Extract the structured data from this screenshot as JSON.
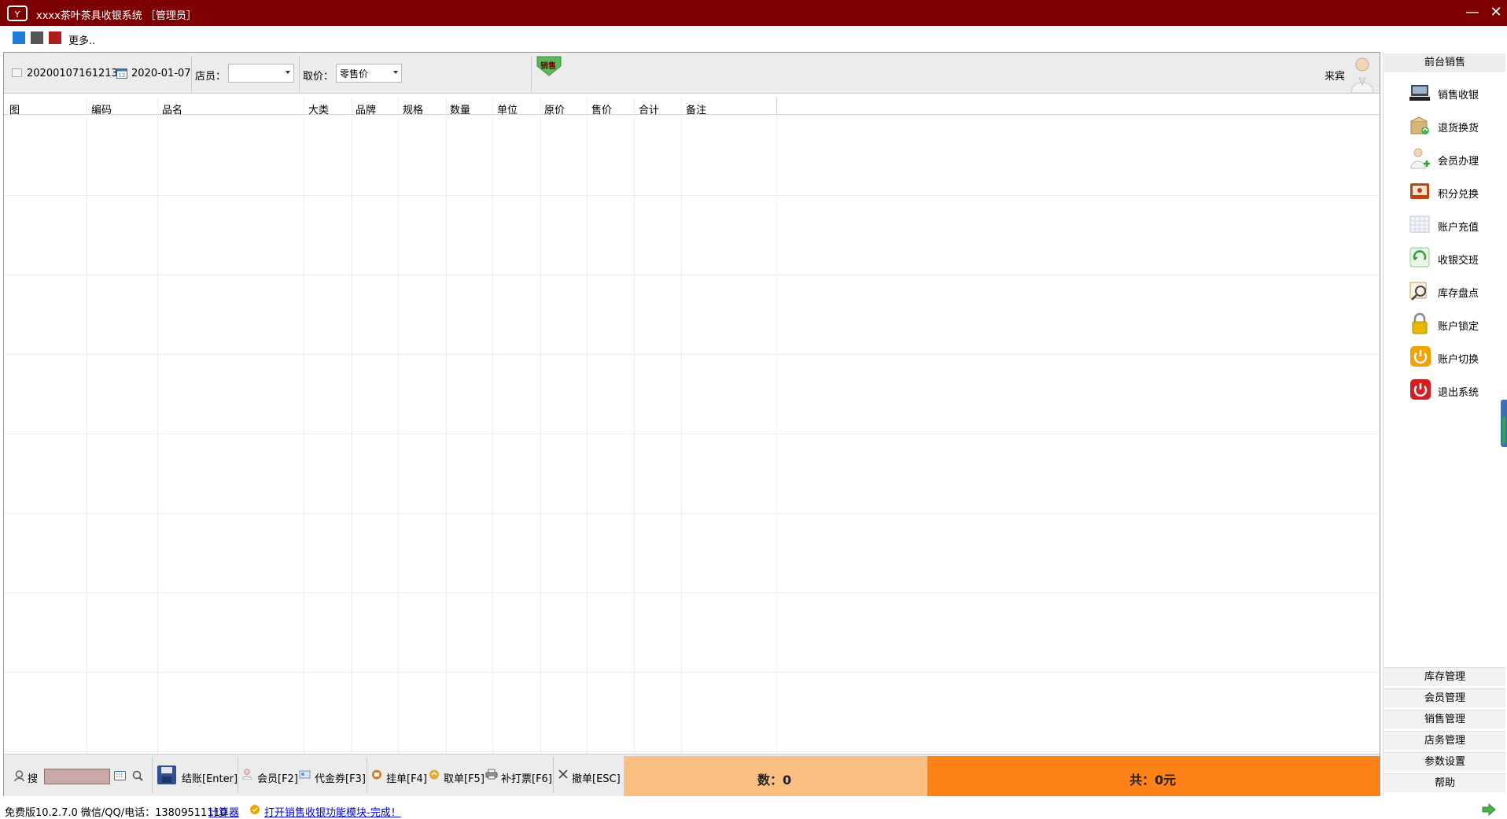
{
  "window": {
    "title": "xxxx茶叶茶具收银系统 ［管理员］",
    "minimize": "—",
    "close": "✕"
  },
  "skins": {
    "colors": [
      "#1e7bd6",
      "#555555",
      "#b01c1c"
    ],
    "more": "更多.."
  },
  "toolbar": {
    "order_no": "20200107161213",
    "date": "2020-01-07",
    "clerk_label": "店员：",
    "clerk_value": "",
    "price_label": "取价：",
    "price_value": "零售价",
    "mode_badge": "销售",
    "customer": "来宾"
  },
  "grid": {
    "columns": [
      "图",
      "编码",
      "品名",
      "大类",
      "品牌",
      "规格",
      "数量",
      "单位",
      "原价",
      "售价",
      "合计",
      "备注"
    ],
    "rows": []
  },
  "bottom": {
    "search_label": "搜",
    "search_value": "",
    "checkout": "结账[Enter]",
    "member": "会员[F2]",
    "voucher": "代金券[F3]",
    "hold": "挂单[F4]",
    "retrieve": "取单[F5]",
    "reprint": "补打票[F6]",
    "cancel": "撤单[ESC]",
    "count_text": "数：0",
    "total_text": "共：0元"
  },
  "sidebar": {
    "header": "前台销售",
    "items": [
      {
        "label": "销售收银",
        "icon": "cash-register-icon",
        "color": "#3a4a5a"
      },
      {
        "label": "退货换货",
        "icon": "return-box-icon",
        "color": "#c9a56a"
      },
      {
        "label": "会员办理",
        "icon": "add-member-icon",
        "color": "#d9c7a3"
      },
      {
        "label": "积分兑换",
        "icon": "points-exchange-icon",
        "color": "#b3481a"
      },
      {
        "label": "账户充值",
        "icon": "recharge-calendar-icon",
        "color": "#cfd6e0"
      },
      {
        "label": "收银交班",
        "icon": "shift-handover-icon",
        "color": "#5fb85f"
      },
      {
        "label": "库存盘点",
        "icon": "inventory-check-icon",
        "color": "#c79a5a"
      },
      {
        "label": "账户锁定",
        "icon": "lock-icon",
        "color": "#e6b800"
      },
      {
        "label": "账户切换",
        "icon": "switch-account-icon",
        "color": "#f2a200"
      },
      {
        "label": "退出系统",
        "icon": "power-off-icon",
        "color": "#d02020"
      }
    ],
    "bottom_items": [
      "库存管理",
      "会员管理",
      "销售管理",
      "店务管理",
      "参数设置",
      "帮助"
    ]
  },
  "status": {
    "version": "免费版10.2.7.0 微信/QQ/电话：13809511110",
    "calculator": "计算器",
    "message": "打开销售收银功能模块-完成！"
  }
}
